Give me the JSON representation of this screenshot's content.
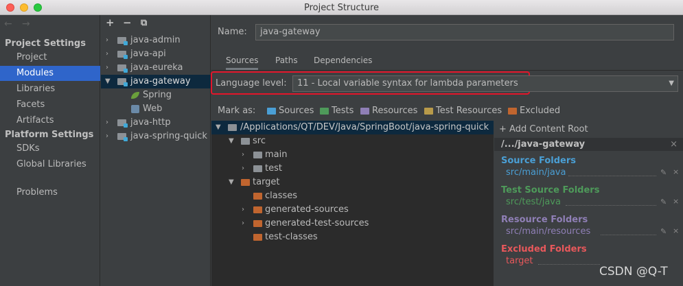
{
  "window": {
    "title": "Project Structure",
    "watermark": "CSDN @Q-T"
  },
  "nav": {
    "back": "←",
    "forward": "→"
  },
  "sidebar": {
    "project_settings": "Project Settings",
    "items_top": [
      "Project",
      "Modules",
      "Libraries",
      "Facets",
      "Artifacts"
    ],
    "platform_settings": "Platform Settings",
    "items_platform": [
      "SDKs",
      "Global Libraries"
    ],
    "problems": "Problems",
    "selected": "Modules"
  },
  "toolbar": {
    "add": "+",
    "remove": "−",
    "copy": "⧉"
  },
  "modules": {
    "items": [
      "java-admin",
      "java-api",
      "java-eureka",
      "java-gateway",
      "Spring",
      "Web",
      "java-http",
      "java-spring-quick"
    ]
  },
  "module": {
    "name_label": "Name:",
    "name_value": "java-gateway",
    "tabs": [
      "Sources",
      "Paths",
      "Dependencies"
    ],
    "active_tab": "Sources",
    "language_label": "Language level:",
    "language_value": "11 - Local variable syntax for lambda parameters"
  },
  "markas": {
    "label": "Mark as:",
    "items": [
      "Sources",
      "Tests",
      "Resources",
      "Test Resources",
      "Excluded"
    ],
    "colors": [
      "#4a9fd5",
      "#4e9a5a",
      "#8f7fb6",
      "#b89a4a",
      "#c0652f"
    ]
  },
  "content_tree": {
    "root": "/Applications/QT/DEV/Java/SpringBoot/java-spring-quick",
    "items": [
      "src",
      "main",
      "test",
      "target",
      "classes",
      "generated-sources",
      "generated-test-sources",
      "test-classes"
    ]
  },
  "content_root": {
    "add_label": "+ Add Content Root",
    "path": "/.../java-gateway",
    "groups": [
      {
        "title": "Source Folders",
        "path": "src/main/java",
        "color": "#4a9fd5"
      },
      {
        "title": "Test Source Folders",
        "path": "src/test/java",
        "color": "#4e9a5a"
      },
      {
        "title": "Resource Folders",
        "path": "src/main/resources",
        "color": "#8f7fb6"
      },
      {
        "title": "Excluded Folders",
        "path": "target",
        "color": "#e8585b"
      }
    ]
  },
  "icons": {
    "close": "×",
    "edit": "✎",
    "arrow_down": "▼",
    "arrow_right": "›"
  }
}
